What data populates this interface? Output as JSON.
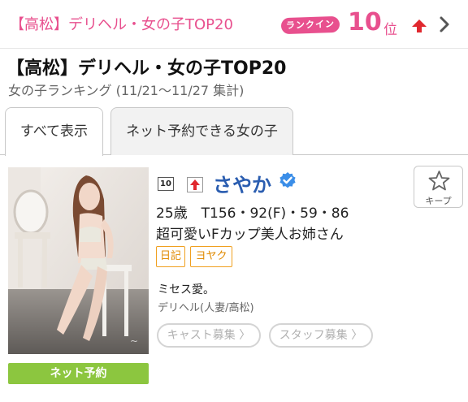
{
  "header": {
    "title": "【高松】デリヘル・女の子TOP20",
    "rankin_badge": "ランクイン",
    "rank_number": "10",
    "rank_suffix": "位"
  },
  "shop_title": "【高松】デリヘル・女の子TOP20",
  "ranking_period": "女の子ランキング (11/21〜11/27 集計)",
  "tabs": [
    {
      "label": "すべて表示",
      "active": true
    },
    {
      "label": "ネット予約できる女の子",
      "active": false
    }
  ],
  "cast": {
    "rank_mini": "10",
    "name": "さやか",
    "stats": "25歳　T156・92(F)・59・86",
    "catch": "超可愛いFカップ美人お姉さん",
    "tags": [
      "日記",
      "ヨヤク"
    ],
    "comment": "ミセス愛。",
    "category": "デリヘル(人妻/高松)",
    "net_reserve": "ネット予約",
    "keep": "キープ",
    "recruit_cast": "キャスト募集 〉",
    "recruit_staff": "スタッフ募集 〉"
  },
  "colors": {
    "accent_pink": "#e8508e",
    "name_blue": "#2a5db0",
    "tag_orange": "#f0a020",
    "reserve_green": "#8cc63f",
    "up_red": "#e0282e"
  },
  "icons": [
    "up-arrow-icon",
    "chevron-right-icon",
    "verified-icon",
    "star-icon"
  ]
}
